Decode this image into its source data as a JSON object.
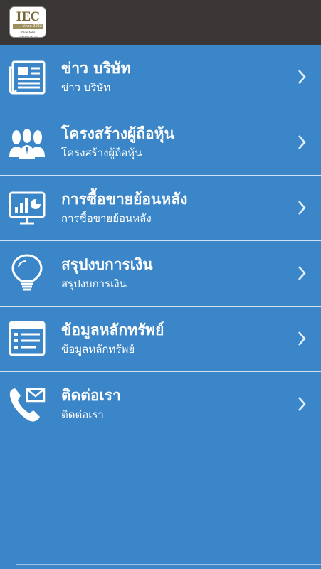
{
  "header": {
    "logo": {
      "mark": "IEC",
      "since": "since 2022",
      "caption": "Investors' Information"
    }
  },
  "menu": [
    {
      "title": "ข่าว บริษัท",
      "subtitle": "ข่าว บริษัท",
      "icon": "newspaper-icon"
    },
    {
      "title": "โครงสร้างผู้ถือหุ้น",
      "subtitle": "โครงสร้างผู้ถือหุ้น",
      "icon": "shareholders-icon"
    },
    {
      "title": "การซื้อขายย้อนหลัง",
      "subtitle": "การซื้อขายย้อนหลัง",
      "icon": "trading-chart-icon"
    },
    {
      "title": "สรุปงบการเงิน",
      "subtitle": "สรุปงบการเงิน",
      "icon": "lightbulb-icon"
    },
    {
      "title": "ข้อมูลหลักทรัพย์",
      "subtitle": "ข้อมูลหลักทรัพย์",
      "icon": "securities-list-icon"
    },
    {
      "title": "ติดต่อเรา",
      "subtitle": "ติดต่อเรา",
      "icon": "contact-phone-icon"
    }
  ],
  "colors": {
    "background": "#3a86c8",
    "topbar": "#3a3636",
    "divider": "#cfe3f3",
    "text": "#ffffff"
  }
}
